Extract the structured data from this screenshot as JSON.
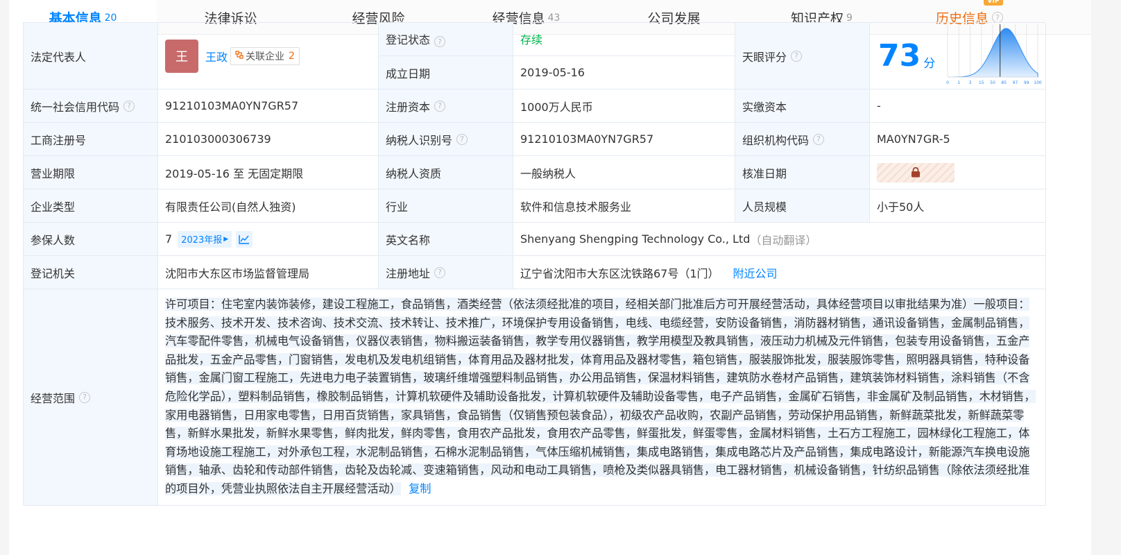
{
  "tabs": [
    {
      "label": "基本信息",
      "count": "20"
    },
    {
      "label": "法律诉讼",
      "count": ""
    },
    {
      "label": "经营风险",
      "count": ""
    },
    {
      "label": "经营信息",
      "count": "43"
    },
    {
      "label": "公司发展",
      "count": ""
    },
    {
      "label": "知识产权",
      "count": "9"
    },
    {
      "label": "历史信息",
      "count": ""
    }
  ],
  "vip_badge": "VIP",
  "help_glyph": "?",
  "labels": {
    "legal_rep": "法定代表人",
    "reg_status": "登记状态",
    "founded": "成立日期",
    "tianyan_score": "天眼评分",
    "credit_code": "统一社会信用代码",
    "reg_capital": "注册资本",
    "paid_capital": "实缴资本",
    "biz_reg_no": "工商注册号",
    "taxpayer_id": "纳税人识别号",
    "org_code": "组织机构代码",
    "biz_term": "营业期限",
    "taxpayer_qual": "纳税人资质",
    "approval_date": "核准日期",
    "company_type": "企业类型",
    "industry": "行业",
    "staff_size": "人员规模",
    "insured": "参保人数",
    "english_name": "英文名称",
    "reg_authority": "登记机关",
    "reg_address": "注册地址",
    "biz_scope": "经营范围"
  },
  "values": {
    "legal_rep_avatar": "王",
    "legal_rep_name": "王政",
    "related_label": "关联企业",
    "related_count": "2",
    "reg_status": "存续",
    "founded": "2019-05-16",
    "score": "73",
    "score_unit": "分",
    "credit_code": "91210103MA0YN7GR57",
    "reg_capital": "1000万人民币",
    "paid_capital": "-",
    "biz_reg_no": "210103000306739",
    "taxpayer_id": "91210103MA0YN7GR57",
    "org_code": "MA0YN7GR-5",
    "biz_term": "2019-05-16 至 无固定期限",
    "taxpayer_qual": "一般纳税人",
    "company_type": "有限责任公司(自然人独资)",
    "industry": "软件和信息技术服务业",
    "staff_size": "小于50人",
    "insured_count": "7",
    "report_year": "2023年报",
    "english_name": "Shenyang Shengping Technology Co., Ltd",
    "english_note": "（自动翻译）",
    "reg_authority": "沈阳市大东区市场监督管理局",
    "reg_address": "辽宁省沈阳市大东区沈铁路67号（1门）",
    "nearby": "附近公司",
    "biz_scope": "许可项目：住宅室内装饰装修，建设工程施工，食品销售，酒类经营（依法须经批准的项目，经相关部门批准后方可开展经营活动，具体经营项目以审批结果为准）一般项目：技术服务、技术开发、技术咨询、技术交流、技术转让、技术推广，环境保护专用设备销售，电线、电缆经营，安防设备销售，消防器材销售，通讯设备销售，金属制品销售，汽车零配件零售，机械电气设备销售，仪器仪表销售，物料搬运装备销售，教学专用仪器销售，教学用模型及教具销售，液压动力机械及元件销售，包装专用设备销售，五金产品批发，五金产品零售，门窗销售，发电机及发电机组销售，体育用品及器材批发，体育用品及器材零售，箱包销售，服装服饰批发，服装服饰零售，照明器具销售，特种设备销售，金属门窗工程施工，先进电力电子装置销售，玻璃纤维增强塑料制品销售，办公用品销售，保温材料销售，建筑防水卷材产品销售，建筑装饰材料销售，涂料销售（不含危险化学品），塑料制品销售，橡胶制品销售，计算机软硬件及辅助设备批发，计算机软硬件及辅助设备零售，电子产品销售，金属矿石销售，非金属矿及制品销售，木材销售，家用电器销售，日用家电零售，日用百货销售，家具销售，食品销售（仅销售预包装食品），初级农产品收购，农副产品销售，劳动保护用品销售，新鲜蔬菜批发，新鲜蔬菜零售，新鲜水果批发，新鲜水果零售，鲜肉批发，鲜肉零售，食用农产品批发，食用农产品零售，鲜蛋批发，鲜蛋零售，金属材料销售，土石方工程施工，园林绿化工程施工，体育场地设施工程施工，对外承包工程，水泥制品销售，石棉水泥制品销售，气体压缩机械销售，集成电路销售，集成电路芯片及产品销售，集成电路设计，新能源汽车换电设施销售，轴承、齿轮和传动部件销售，齿轮及齿轮减、变速箱销售，风动和电动工具销售，喷枪及类似器具销售，电工器材销售，机械设备销售，针纺织品销售（除依法须经批准的项目外，凭营业执照依法自主开展经营活动）",
    "copy": "复制"
  },
  "score_chart": {
    "ticks": [
      "0",
      "1",
      "3",
      "15",
      "50",
      "85",
      "97",
      "99",
      "100"
    ],
    "score": 73,
    "fill_color": "#2f8bf0",
    "marker_color": "#333333"
  },
  "colors": {
    "accent": "#0084ff",
    "orange": "#ee6b0d",
    "status_green": "#00b54b",
    "label_bg": "#f3f8fe"
  }
}
